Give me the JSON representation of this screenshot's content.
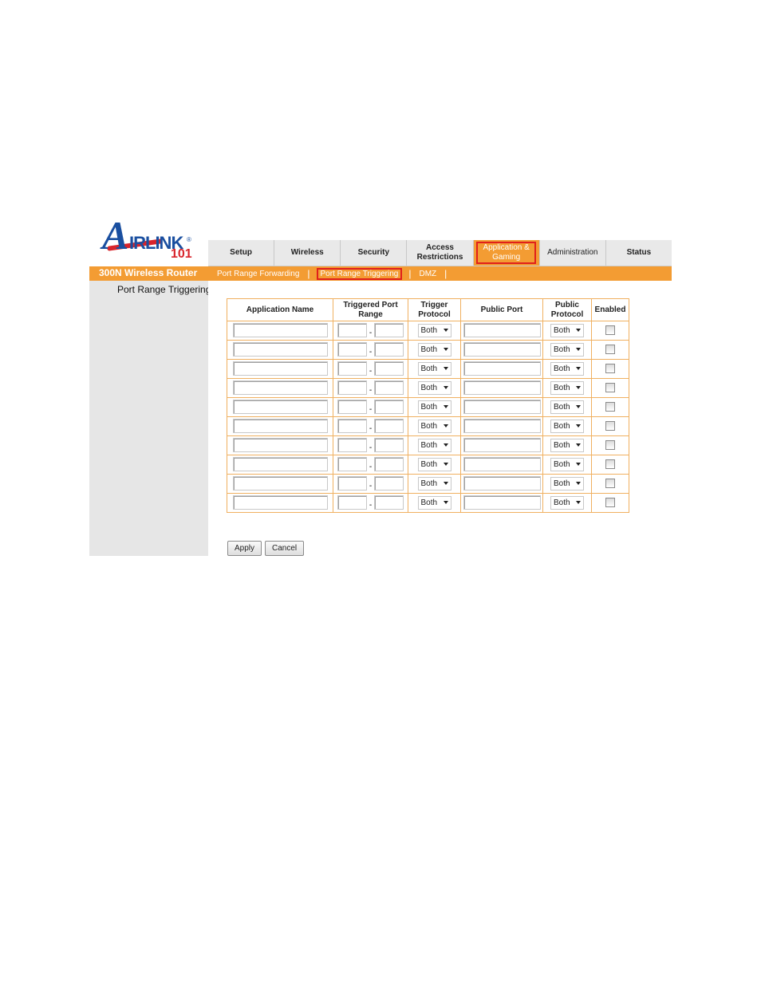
{
  "brand": {
    "logo_a": "A",
    "logo_text": "IRLINK",
    "logo_reg": "®",
    "logo_number": "101"
  },
  "product_name": "300N Wireless Router",
  "tabs": [
    {
      "label": "Setup",
      "active": false
    },
    {
      "label": "Wireless",
      "active": false
    },
    {
      "label": "Security",
      "active": false
    },
    {
      "label": "Access Restrictions",
      "active": false
    },
    {
      "label": "Application & Gaming",
      "active": true
    },
    {
      "label": "Administration",
      "active": false
    },
    {
      "label": "Status",
      "active": false
    }
  ],
  "subnav": [
    {
      "label": "Port Range Forwarding",
      "current": false
    },
    {
      "label": "Port Range Triggering",
      "current": true
    },
    {
      "label": "DMZ",
      "current": false
    }
  ],
  "sidebar": {
    "title": "Port Range Triggering"
  },
  "table": {
    "headers": [
      "Application Name",
      "Triggered Port Range",
      "Trigger Protocol",
      "Public Port",
      "Public Protocol",
      "Enabled"
    ],
    "port_separator": "-",
    "rows": [
      {
        "app_name": "",
        "trig_start": "",
        "trig_end": "",
        "trig_protocol": "Both",
        "public_port": "",
        "public_protocol": "Both",
        "enabled": false
      },
      {
        "app_name": "",
        "trig_start": "",
        "trig_end": "",
        "trig_protocol": "Both",
        "public_port": "",
        "public_protocol": "Both",
        "enabled": false
      },
      {
        "app_name": "",
        "trig_start": "",
        "trig_end": "",
        "trig_protocol": "Both",
        "public_port": "",
        "public_protocol": "Both",
        "enabled": false
      },
      {
        "app_name": "",
        "trig_start": "",
        "trig_end": "",
        "trig_protocol": "Both",
        "public_port": "",
        "public_protocol": "Both",
        "enabled": false
      },
      {
        "app_name": "",
        "trig_start": "",
        "trig_end": "",
        "trig_protocol": "Both",
        "public_port": "",
        "public_protocol": "Both",
        "enabled": false
      },
      {
        "app_name": "",
        "trig_start": "",
        "trig_end": "",
        "trig_protocol": "Both",
        "public_port": "",
        "public_protocol": "Both",
        "enabled": false
      },
      {
        "app_name": "",
        "trig_start": "",
        "trig_end": "",
        "trig_protocol": "Both",
        "public_port": "",
        "public_protocol": "Both",
        "enabled": false
      },
      {
        "app_name": "",
        "trig_start": "",
        "trig_end": "",
        "trig_protocol": "Both",
        "public_port": "",
        "public_protocol": "Both",
        "enabled": false
      },
      {
        "app_name": "",
        "trig_start": "",
        "trig_end": "",
        "trig_protocol": "Both",
        "public_port": "",
        "public_protocol": "Both",
        "enabled": false
      },
      {
        "app_name": "",
        "trig_start": "",
        "trig_end": "",
        "trig_protocol": "Both",
        "public_port": "",
        "public_protocol": "Both",
        "enabled": false
      }
    ]
  },
  "buttons": {
    "apply": "Apply",
    "cancel": "Cancel"
  },
  "colors": {
    "accent_orange": "#f39c33",
    "highlight_red": "#e0201b",
    "brand_blue": "#1a4fa0"
  }
}
